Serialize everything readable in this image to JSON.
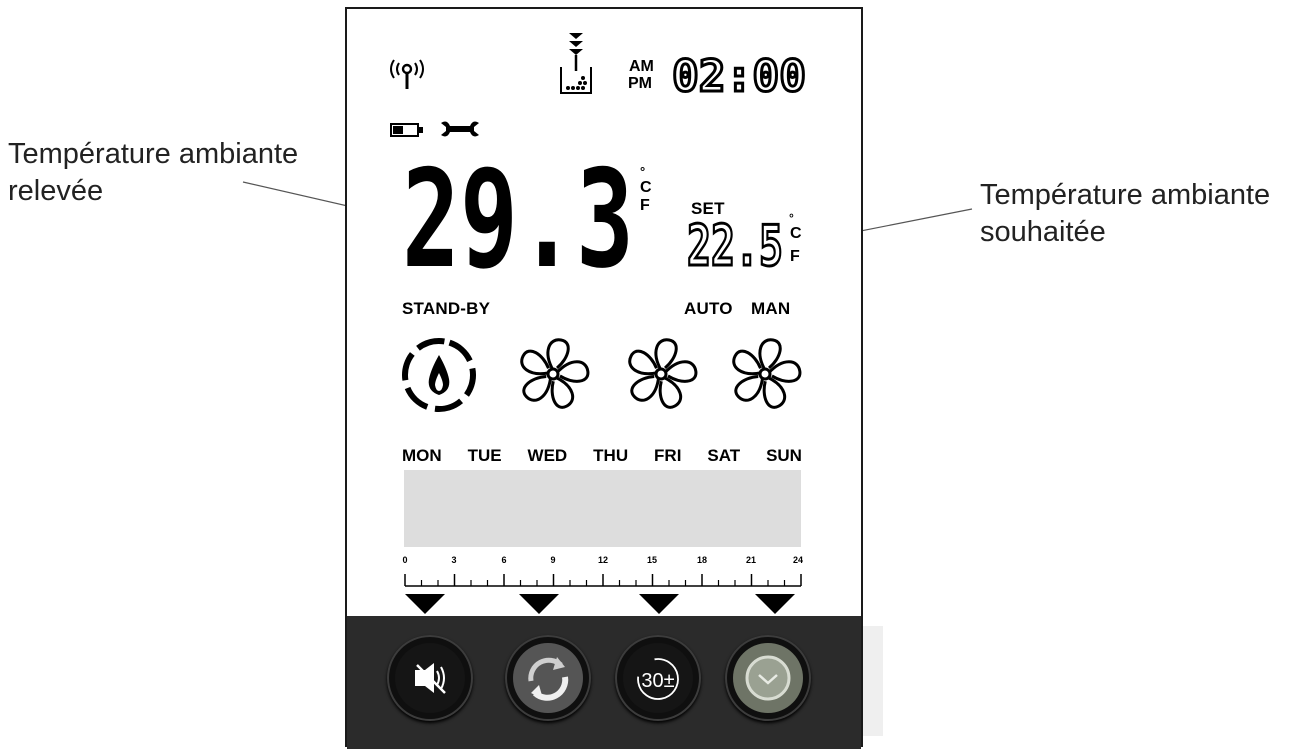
{
  "callouts": {
    "left": {
      "line1": "Température ambiante",
      "line2": "relevée"
    },
    "right": {
      "line1": "Température ambiante",
      "line2": "souhaitée"
    }
  },
  "display": {
    "clock": {
      "am": "AM",
      "pm": "PM",
      "time": "02:00"
    },
    "room_temperature": "29.3",
    "set_label": "SET",
    "set_temperature": "22.5",
    "unit_degree": "°",
    "unit_c": "C",
    "unit_f": "F",
    "mode_standby": "STAND-BY",
    "mode_auto": "AUTO",
    "mode_man": "MAN",
    "days": [
      "MON",
      "TUE",
      "WED",
      "THU",
      "FRI",
      "SAT",
      "SUN"
    ],
    "timeline_ticks": [
      "0",
      "3",
      "6",
      "9",
      "12",
      "15",
      "18",
      "21",
      "24"
    ]
  },
  "icons": {
    "status": [
      "antenna-icon",
      "pellet-hopper-icon",
      "battery-icon",
      "wrench-icon"
    ],
    "modes": [
      "flame-icon",
      "fan-icon",
      "fan-icon",
      "fan-icon"
    ],
    "buttons": [
      "mute-icon",
      "refresh-icon",
      "timer-30-icon",
      "clock-icon"
    ]
  },
  "buttons": {
    "timer_label": "30±"
  },
  "colors": {
    "lcd_text": "#000000",
    "control_bar": "#2b2b2b",
    "schedule_band": "#dddddd"
  }
}
